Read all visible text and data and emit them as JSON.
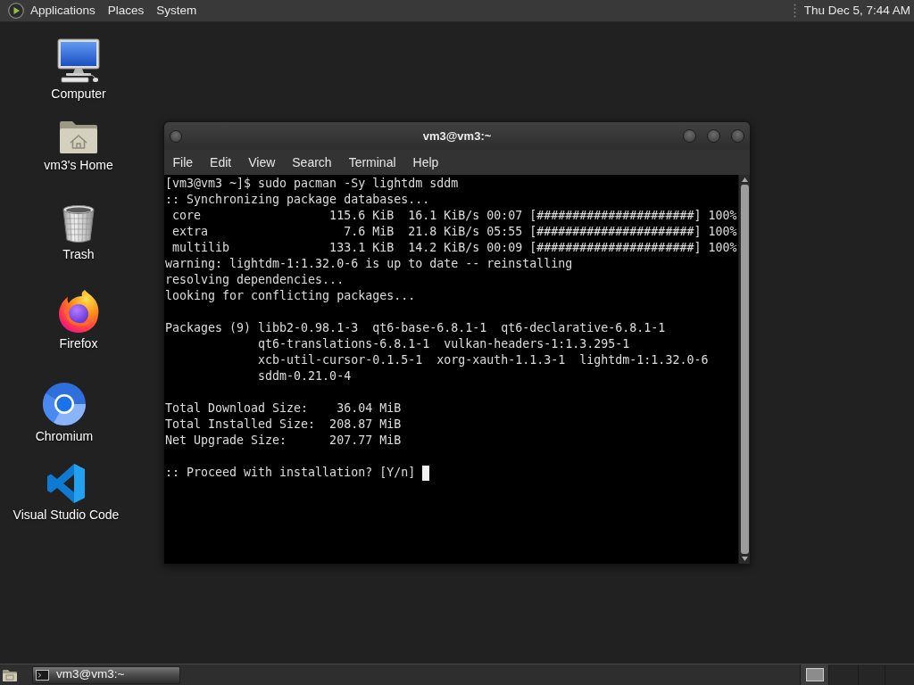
{
  "top_panel": {
    "menus": [
      "Applications",
      "Places",
      "System"
    ],
    "clock": "Thu Dec 5, 7:44 AM"
  },
  "desktop_icons": [
    {
      "label": "Computer",
      "kind": "computer"
    },
    {
      "label": "vm3's Home",
      "kind": "home"
    },
    {
      "label": "Trash",
      "kind": "trash"
    },
    {
      "label": "Firefox",
      "kind": "firefox"
    },
    {
      "label": "Chromium",
      "kind": "chromium"
    },
    {
      "label": "Visual Studio Code",
      "kind": "vscode"
    }
  ],
  "terminal_window": {
    "title": "vm3@vm3:~",
    "menu_bar": [
      "File",
      "Edit",
      "View",
      "Search",
      "Terminal",
      "Help"
    ],
    "output_blocks": [
      [
        "[vm3@vm3 ~]$ sudo pacman -Sy lightdm sddm",
        ":: Synchronizing package databases...",
        " core                  115.6 KiB  16.1 KiB/s 00:07 [######################] 100%",
        " extra                   7.6 MiB  21.8 KiB/s 05:55 [######################] 100%",
        " multilib              133.1 KiB  14.2 KiB/s 00:09 [######################] 100%",
        "warning: lightdm-1:1.32.0-6 is up to date -- reinstalling",
        "resolving dependencies...",
        "looking for conflicting packages..."
      ],
      [
        "Packages (9) libb2-0.98.1-3  qt6-base-6.8.1-1  qt6-declarative-6.8.1-1",
        "             qt6-translations-6.8.1-1  vulkan-headers-1:1.3.295-1",
        "             xcb-util-cursor-0.1.5-1  xorg-xauth-1.1.3-1  lightdm-1:1.32.0-6",
        "             sddm-0.21.0-4"
      ],
      [
        "Total Download Size:    36.04 MiB",
        "Total Installed Size:  208.87 MiB",
        "Net Upgrade Size:      207.77 MiB"
      ]
    ],
    "input_line": {
      "text": ":: Proceed with installation? [Y/n]",
      "cursor": true
    }
  },
  "taskbar": {
    "tasks": [
      {
        "label": "vm3@vm3:~",
        "selected": true
      }
    ]
  }
}
